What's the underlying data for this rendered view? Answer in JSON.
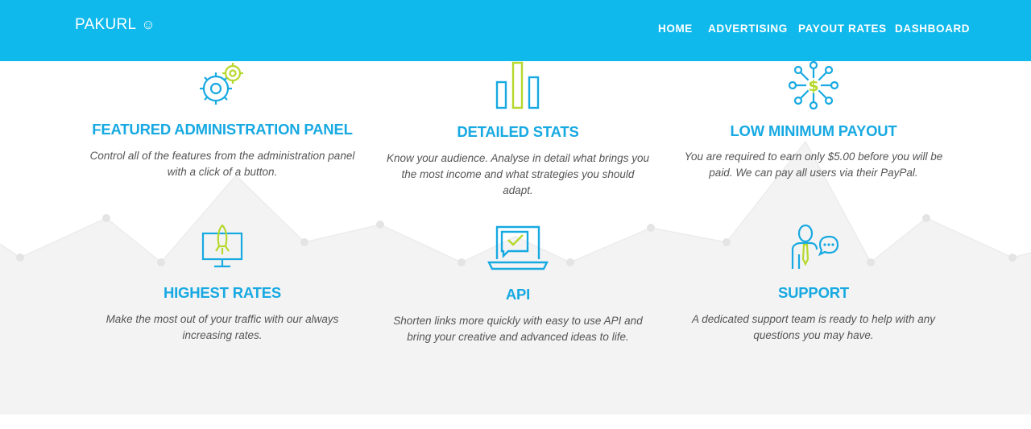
{
  "header": {
    "brand": "PAKURL",
    "brand_glyph": "☺",
    "nav": [
      {
        "label": "HOME"
      },
      {
        "label": "ADVERTISING"
      },
      {
        "label": "PAYOUT RATES"
      },
      {
        "label": "DASHBOARD"
      }
    ]
  },
  "colors": {
    "header_bg": "#0fb9ec",
    "icon_blue": "#17a9e2",
    "icon_green": "#b5d82c",
    "heading": "#17a9e2",
    "band_bg": "#f3f3f3"
  },
  "features": [
    {
      "icon": "gears-icon",
      "title": "FEATURED ADMINISTRATION PANEL",
      "text": "Control all of the features from the administration panel with a click of a button."
    },
    {
      "icon": "bar-chart-icon",
      "title": "DETAILED STATS",
      "text": "Know your audience. Analyse in detail what brings you the most income and what strategies you should adapt."
    },
    {
      "icon": "dollar-network-icon",
      "title": "LOW MINIMUM PAYOUT",
      "text": "You are required to earn only $5.00 before you will be paid. We can pay all users via their PayPal."
    },
    {
      "icon": "rocket-monitor-icon",
      "title": "HIGHEST RATES",
      "text": "Make the most out of your traffic with our always increasing rates."
    },
    {
      "icon": "laptop-chat-icon",
      "title": "API",
      "text": "Shorten links more quickly with easy to use API and bring your creative and advanced ideas to life."
    },
    {
      "icon": "support-agent-icon",
      "title": "SUPPORT",
      "text": "A dedicated support team is ready to help with any questions you may have."
    }
  ]
}
